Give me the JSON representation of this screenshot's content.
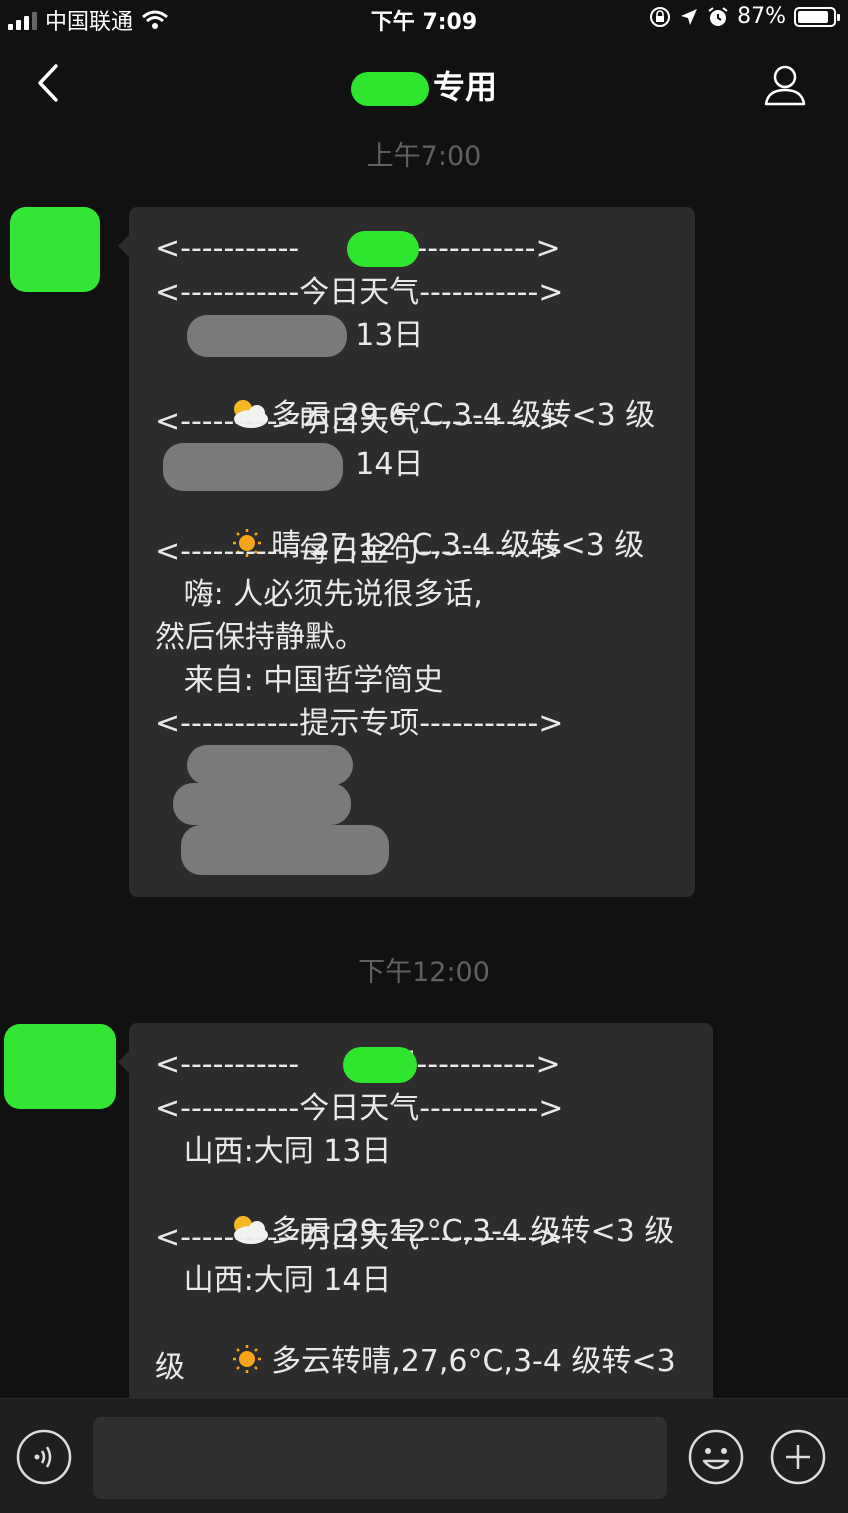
{
  "status_bar": {
    "carrier": "中国联通",
    "time": "下午 7:09",
    "battery": "87%"
  },
  "nav": {
    "title": "专用"
  },
  "messages": [
    {
      "timestamp": "上午7:00",
      "lines": [
        "<-----------      专用----------->",
        "<-----------今日天气----------->",
        "                     13日",
        "多云,29,6°C,3-4 级转<3 级",
        "<-----------明日天气----------->",
        "                     14日",
        "晴,27,12°C,3-4 级转<3 级",
        "<-----------每日金句----------->",
        "   嗨: 人必须先说很多话,",
        "然后保持静默。",
        "   来自: 中国哲学简史",
        "<-----------提示专项----------->"
      ]
    },
    {
      "timestamp": "下午12:00",
      "lines": [
        "<-----------      专用----------->",
        "<-----------今日天气----------->",
        "   山西:大同 13日",
        "多云,29,12°C,3-4 级转<3 级",
        "<-----------明日天气----------->",
        "   山西:大同 14日",
        "多云转晴,27,6°C,3-4 级转<3",
        "级"
      ]
    }
  ],
  "input_bar": {
    "placeholder": ""
  },
  "colors": {
    "background": "#111111",
    "bubble": "#2c2c2c",
    "redaction_green": "#2ee52e",
    "redaction_gray": "#7a7a7a",
    "timestamp": "#606060"
  }
}
